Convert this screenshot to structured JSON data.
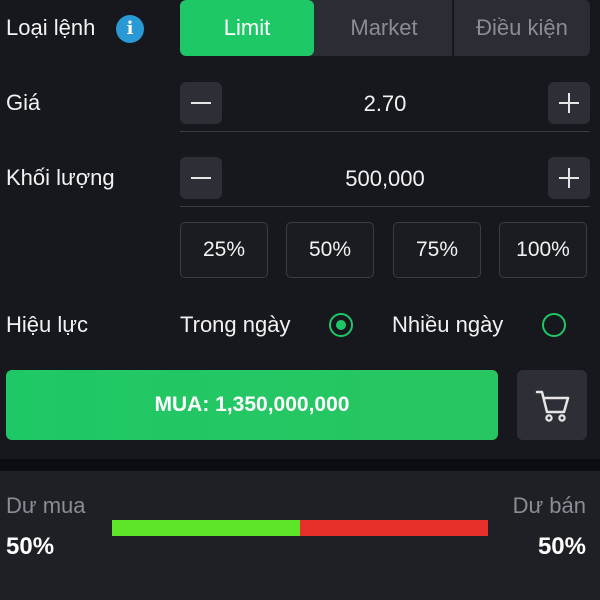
{
  "order_type": {
    "label": "Loại lệnh",
    "info_icon": "info-icon",
    "tabs": [
      {
        "label": "Limit",
        "active": true
      },
      {
        "label": "Market",
        "active": false
      },
      {
        "label": "Điều kiện",
        "active": false
      }
    ]
  },
  "price": {
    "label": "Giá",
    "value": "2.70",
    "minus_icon": "minus-icon",
    "plus_icon": "plus-icon"
  },
  "quantity": {
    "label": "Khối lượng",
    "value": "500,000",
    "minus_icon": "minus-icon",
    "plus_icon": "plus-icon"
  },
  "percent_buttons": [
    "25%",
    "50%",
    "75%",
    "100%"
  ],
  "validity": {
    "label": "Hiệu lực",
    "options": [
      {
        "label": "Trong ngày",
        "selected": true
      },
      {
        "label": "Nhiều ngày",
        "selected": false
      }
    ]
  },
  "buy_button": {
    "label": "MUA: 1,350,000,000"
  },
  "cart_icon": "cart-icon",
  "market_depth": {
    "buy_label": "Dư mua",
    "sell_label": "Dư bán",
    "buy_pct": "50%",
    "sell_pct": "50%",
    "buy_fraction": 0.5,
    "buy_color": "#5ee52a",
    "sell_color": "#e8302a"
  },
  "colors": {
    "accent": "#1fc866",
    "background": "#16181d",
    "info": "#2a9ad6"
  }
}
